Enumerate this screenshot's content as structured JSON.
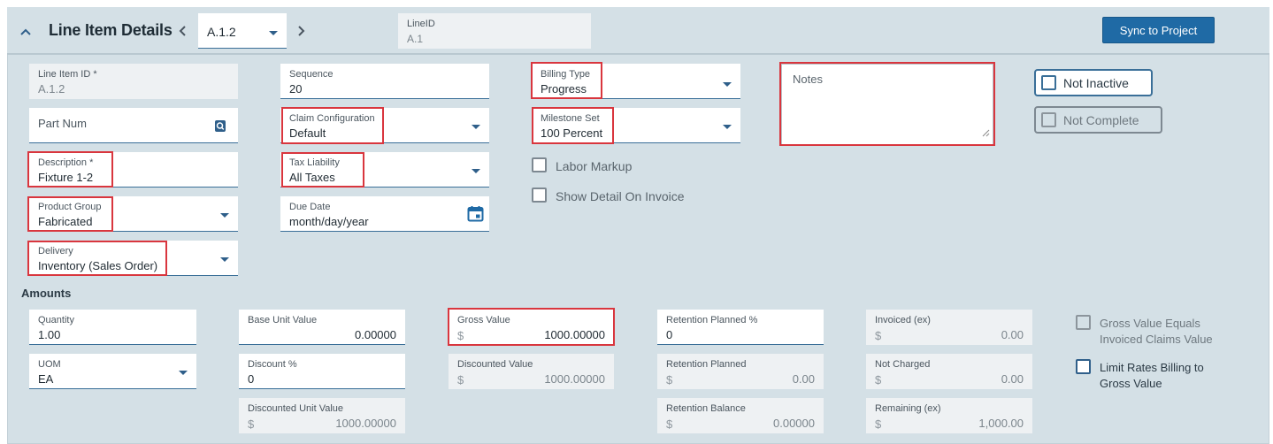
{
  "header": {
    "title": "Line Item Details",
    "nav_value": "A.1.2",
    "lineid_label": "LineID",
    "lineid_value": "A.1",
    "sync_button": "Sync to Project"
  },
  "fields": {
    "line_item_id": {
      "label": "Line Item ID *",
      "value": "A.1.2"
    },
    "part_num": {
      "label": "Part Num"
    },
    "description": {
      "label": "Description *",
      "value": "Fixture 1-2"
    },
    "product_group": {
      "label": "Product Group",
      "value": "Fabricated"
    },
    "delivery": {
      "label": "Delivery",
      "value": "Inventory (Sales Order)"
    },
    "sequence": {
      "label": "Sequence",
      "value": "20"
    },
    "claim_configuration": {
      "label": "Claim Configuration",
      "value": "Default"
    },
    "tax_liability": {
      "label": "Tax Liability",
      "value": "All Taxes"
    },
    "due_date": {
      "label": "Due Date",
      "value": "month/day/year"
    },
    "billing_type": {
      "label": "Billing Type",
      "value": "Progress"
    },
    "milestone_set": {
      "label": "Milestone Set",
      "value": "100 Percent"
    },
    "notes": {
      "placeholder": "Notes"
    }
  },
  "checkboxes": {
    "labor_markup": "Labor Markup",
    "show_detail": "Show Detail On Invoice",
    "not_inactive": "Not Inactive",
    "not_complete": "Not Complete",
    "gross_equals_1": "Gross Value Equals",
    "gross_equals_2": "Invoiced Claims Value",
    "limit_rates_1": "Limit Rates Billing to",
    "limit_rates_2": "Gross Value"
  },
  "amounts": {
    "section_title": "Amounts",
    "quantity": {
      "label": "Quantity",
      "value": "1.00"
    },
    "uom": {
      "label": "UOM",
      "value": "EA"
    },
    "base_unit_value": {
      "label": "Base Unit Value",
      "value": "0.00000"
    },
    "discount_pct": {
      "label": "Discount %",
      "value": "0"
    },
    "discounted_unit_value": {
      "label": "Discounted Unit Value",
      "value": "1000.00000"
    },
    "gross_value": {
      "label": "Gross Value",
      "value": "1000.00000"
    },
    "discounted_value": {
      "label": "Discounted Value",
      "value": "1000.00000"
    },
    "retention_planned_pct": {
      "label": "Retention Planned %",
      "value": "0"
    },
    "retention_planned": {
      "label": "Retention Planned",
      "value": "0.00"
    },
    "retention_balance": {
      "label": "Retention Balance",
      "value": "0.00000"
    },
    "invoiced_ex": {
      "label": "Invoiced (ex)",
      "value": "0.00"
    },
    "not_charged": {
      "label": "Not Charged",
      "value": "0.00"
    },
    "remaining_ex": {
      "label": "Remaining (ex)",
      "value": "1,000.00"
    },
    "currency_symbol": "$"
  },
  "colors": {
    "accent": "#1f6aa5",
    "highlight": "#d9363e",
    "panel": "#d4e0e6"
  }
}
